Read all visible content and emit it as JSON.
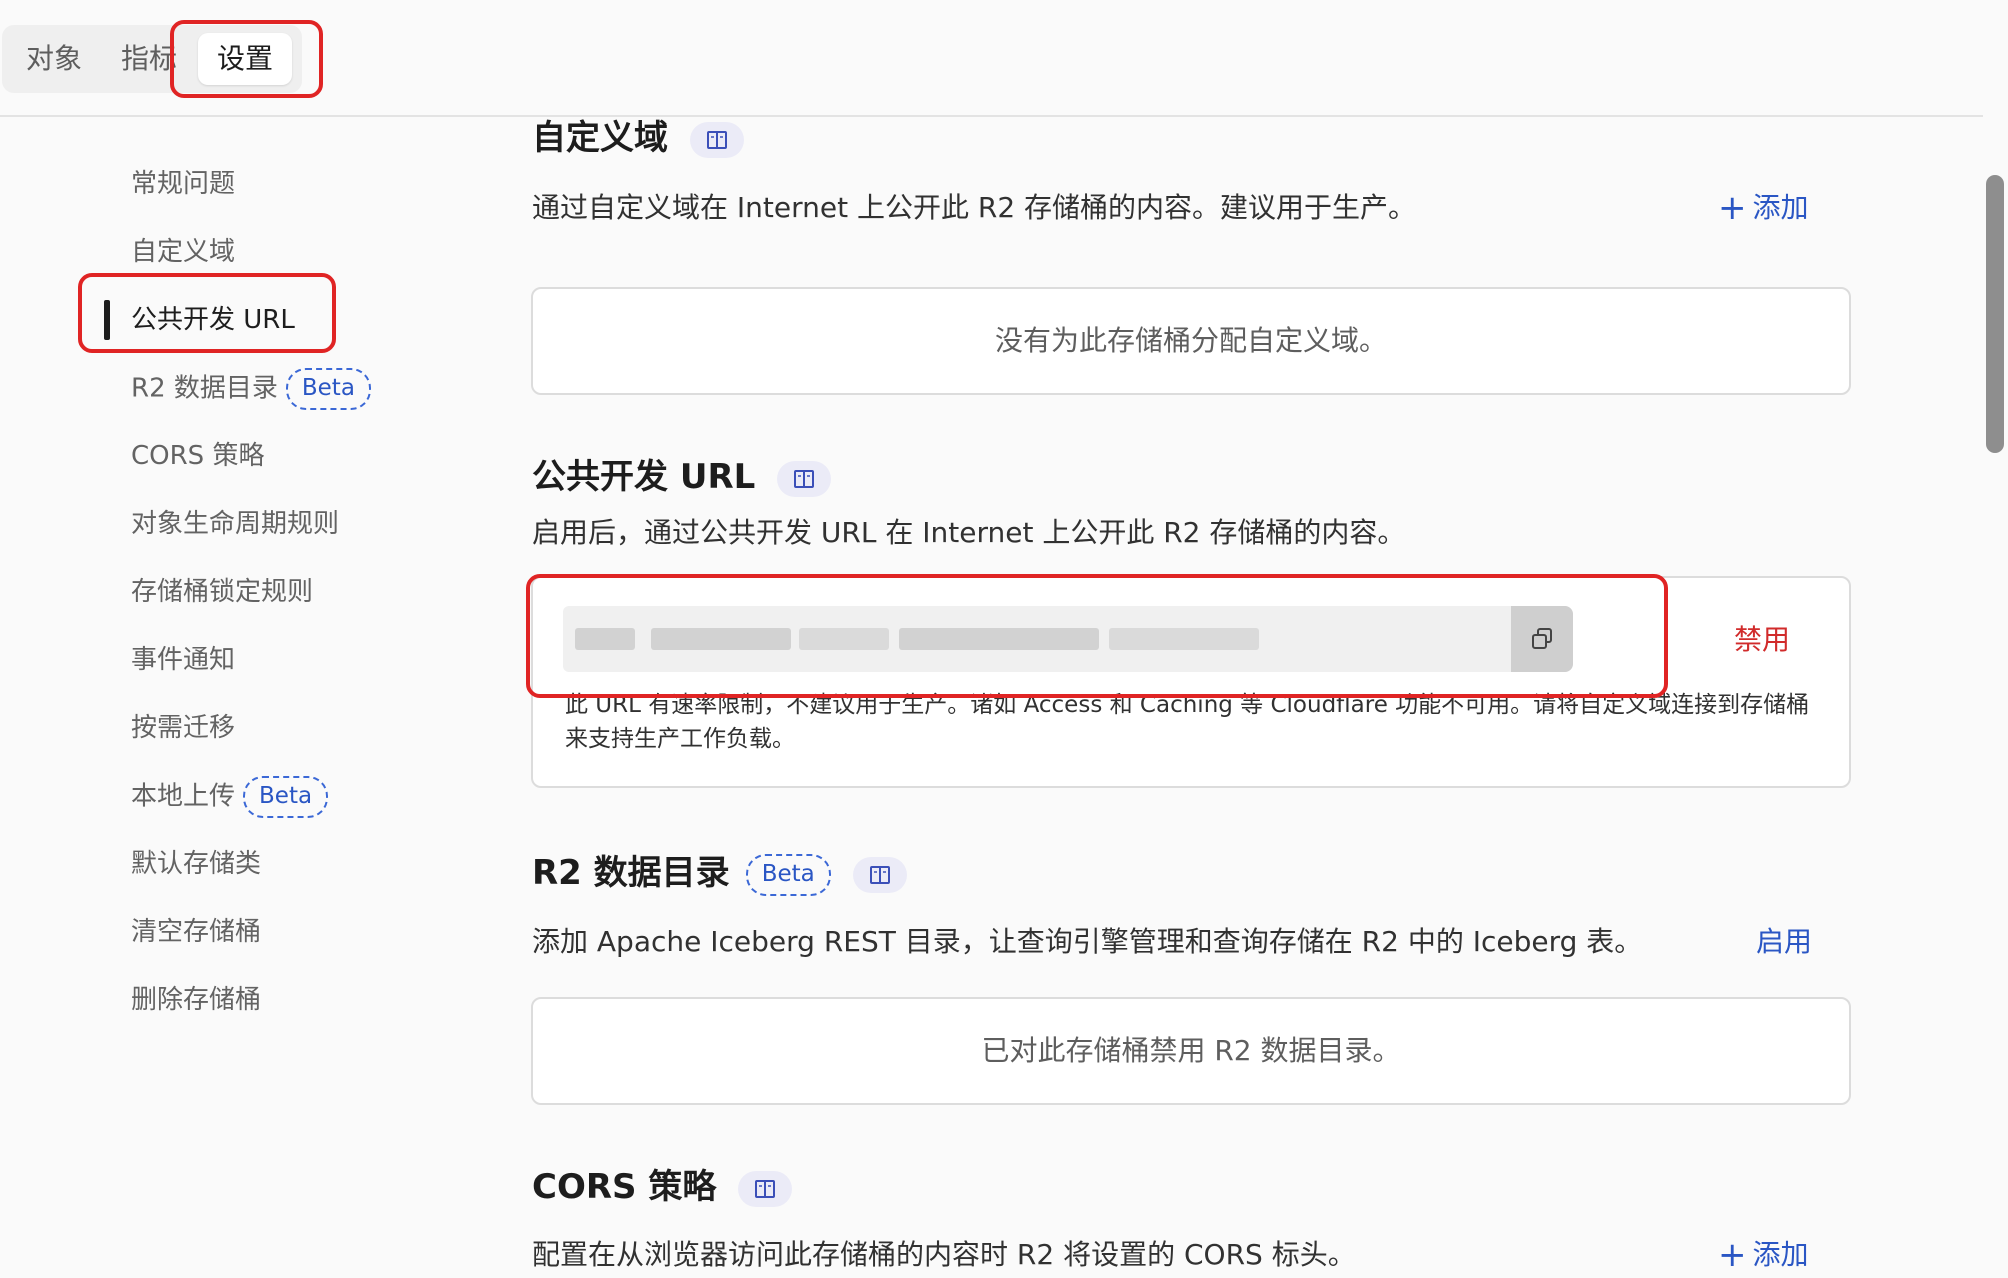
{
  "tabs": [
    {
      "label": "对象"
    },
    {
      "label": "指标"
    },
    {
      "label": "设置"
    }
  ],
  "sidebar": {
    "items": [
      {
        "label": "常规问题"
      },
      {
        "label": "自定义域"
      },
      {
        "label": "公共开发 URL"
      },
      {
        "label": "R2 数据目录",
        "badge": "Beta"
      },
      {
        "label": "CORS 策略"
      },
      {
        "label": "对象生命周期规则"
      },
      {
        "label": "存储桶锁定规则"
      },
      {
        "label": "事件通知"
      },
      {
        "label": "按需迁移"
      },
      {
        "label": "本地上传",
        "badge": "Beta"
      },
      {
        "label": "默认存储类"
      },
      {
        "label": "清空存储桶"
      },
      {
        "label": "删除存储桶"
      }
    ]
  },
  "sections": {
    "custom_domain": {
      "title": "自定义域",
      "description": "通过自定义域在 Internet 上公开此 R2 存储桶的内容。建议用于生产。",
      "action": "添加",
      "empty_text": "没有为此存储桶分配自定义域。"
    },
    "public_dev_url": {
      "title": "公共开发 URL",
      "description": "启用后，通过公共开发 URL 在 Internet 上公开此 R2 存储桶的内容。",
      "action": "禁用",
      "note": "此 URL 有速率限制，不建议用于生产。诸如 Access 和 Caching 等 Cloudflare 功能不可用。请将自定义域连接到存储桶来支持生产工作负载。"
    },
    "data_catalog": {
      "title": "R2 数据目录",
      "badge": "Beta",
      "description": "添加 Apache Iceberg REST 目录，让查询引擎管理和查询存储在 R2 中的 Iceberg 表。",
      "action": "启用",
      "empty_text": "已对此存储桶禁用 R2 数据目录。"
    },
    "cors": {
      "title": "CORS 策略",
      "description": "配置在从浏览器访问此存储桶的内容时 R2 将设置的 CORS 标头。",
      "action": "添加"
    }
  },
  "colors": {
    "accent": "#2a56c4",
    "danger": "#d12b2b",
    "highlight": "#e02424"
  }
}
